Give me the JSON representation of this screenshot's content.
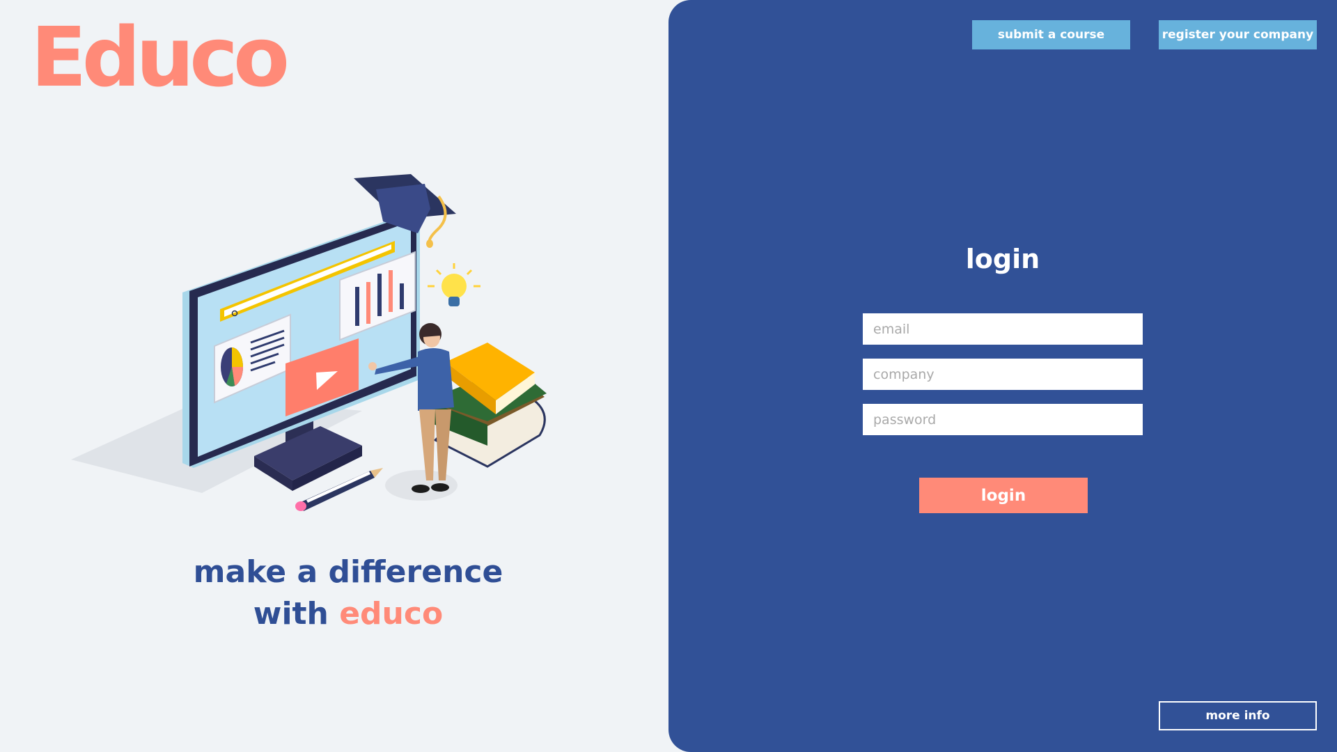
{
  "brand": {
    "logo_text": "Educo",
    "accent_color": "#ff8a78",
    "primary_color": "#315197"
  },
  "tagline": {
    "line1": "make a difference",
    "line2_prefix": "with",
    "line2_accent": "educo"
  },
  "header": {
    "submit_course_label": "submit a course",
    "register_company_label": "register your company"
  },
  "login": {
    "title": "login",
    "email_placeholder": "email",
    "company_placeholder": "company",
    "password_placeholder": "password",
    "button_label": "login"
  },
  "footer": {
    "more_info_label": "more info"
  },
  "illustration": {
    "icons": [
      "monitor-icon",
      "graduation-cap-icon",
      "lightbulb-icon",
      "books-icon",
      "person-icon",
      "pencil-icon",
      "play-icon",
      "bar-chart-icon",
      "pie-chart-icon",
      "search-icon"
    ]
  }
}
